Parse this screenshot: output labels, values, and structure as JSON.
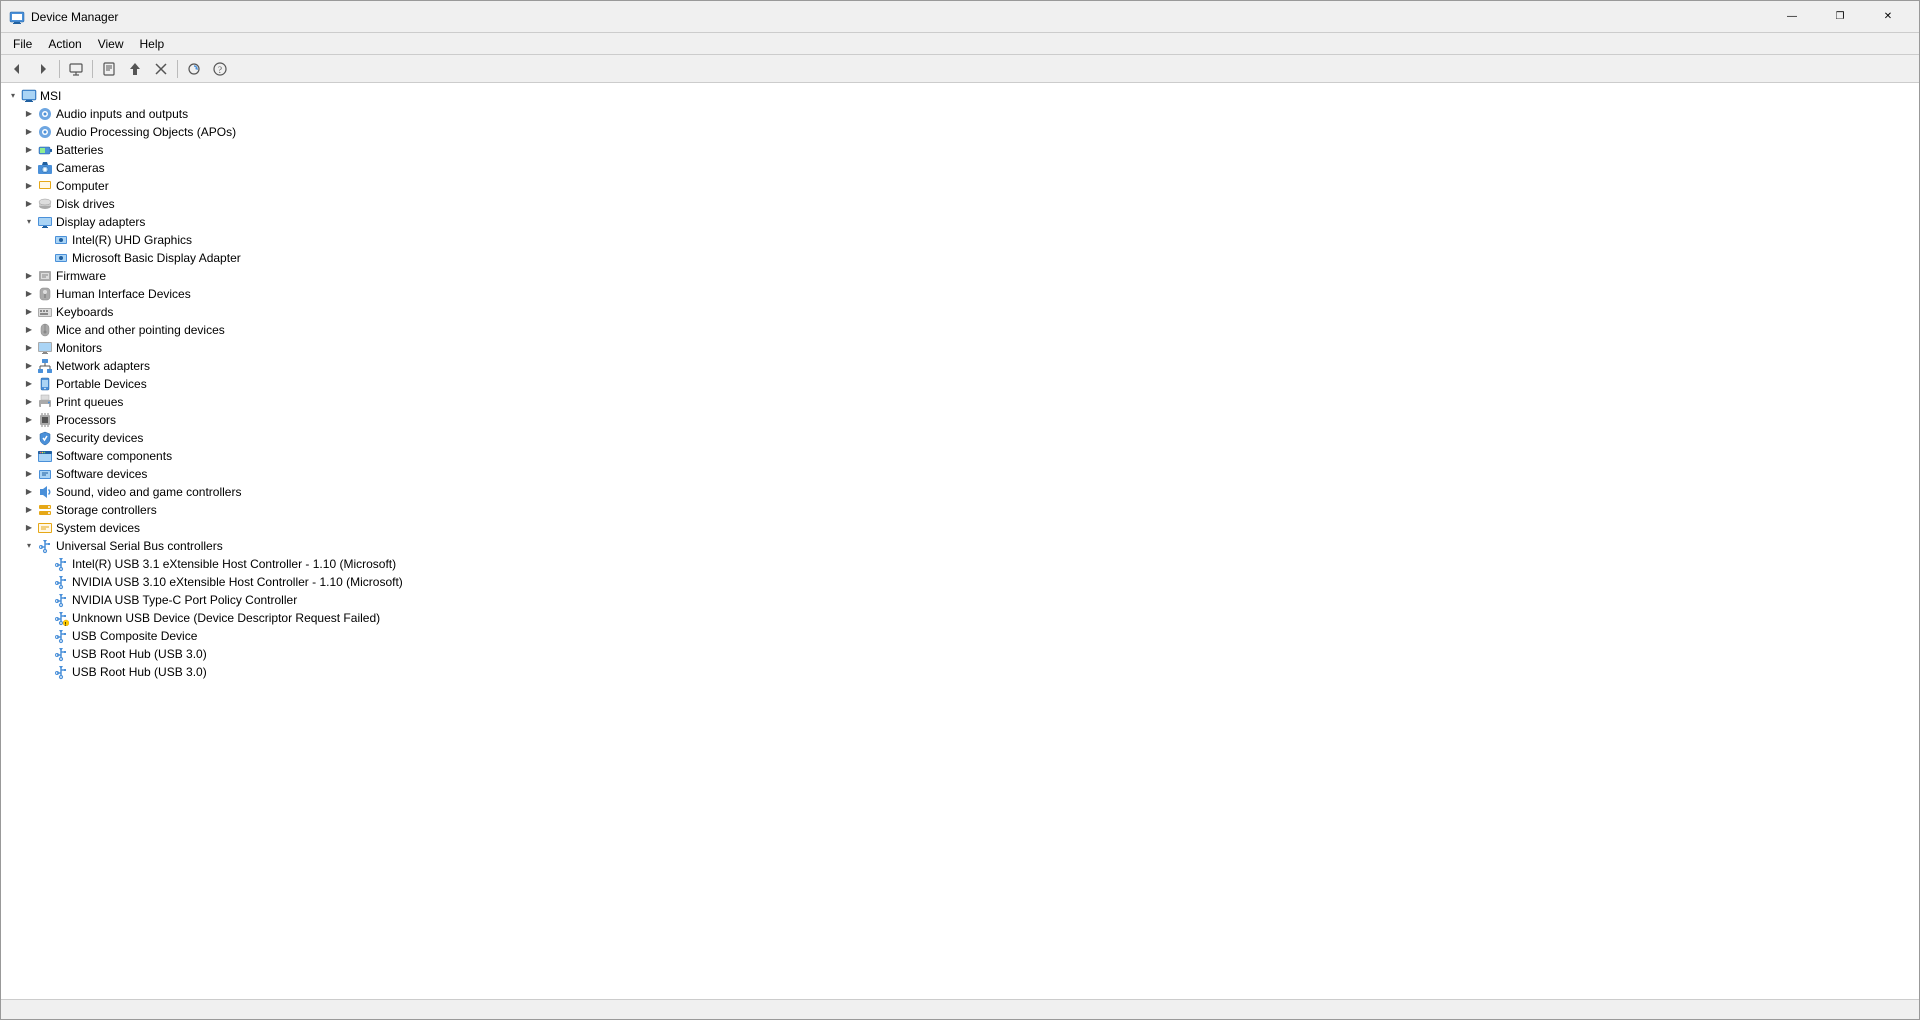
{
  "window": {
    "title": "Device Manager",
    "icon": "device-manager-icon"
  },
  "title_buttons": {
    "minimize": "—",
    "restore": "❐",
    "close": "✕"
  },
  "menu": {
    "items": [
      {
        "label": "File",
        "id": "file"
      },
      {
        "label": "Action",
        "id": "action"
      },
      {
        "label": "View",
        "id": "view"
      },
      {
        "label": "Help",
        "id": "help"
      }
    ]
  },
  "toolbar": {
    "buttons": [
      {
        "name": "back-button",
        "icon": "◀"
      },
      {
        "name": "forward-button",
        "icon": "▶"
      },
      {
        "name": "refresh-button",
        "icon": "⟳"
      },
      {
        "name": "properties-button",
        "icon": "🔲"
      },
      {
        "name": "update-driver-button",
        "icon": "⬆"
      },
      {
        "name": "uninstall-button",
        "icon": "✕"
      },
      {
        "name": "scan-hardware-button",
        "icon": "🔍"
      },
      {
        "name": "help-button",
        "icon": "?"
      }
    ]
  },
  "tree": {
    "root": {
      "label": "MSI",
      "expanded": true,
      "children": [
        {
          "label": "Audio inputs and outputs",
          "expanded": false,
          "icon": "audio",
          "children": []
        },
        {
          "label": "Audio Processing Objects (APOs)",
          "expanded": false,
          "icon": "audio",
          "children": []
        },
        {
          "label": "Batteries",
          "expanded": false,
          "icon": "battery",
          "children": []
        },
        {
          "label": "Cameras",
          "expanded": false,
          "icon": "camera",
          "children": []
        },
        {
          "label": "Computer",
          "expanded": false,
          "icon": "computer",
          "children": []
        },
        {
          "label": "Disk drives",
          "expanded": false,
          "icon": "disk",
          "children": []
        },
        {
          "label": "Display adapters",
          "expanded": true,
          "icon": "display",
          "children": [
            {
              "label": "Intel(R) UHD Graphics",
              "icon": "display-device"
            },
            {
              "label": "Microsoft Basic Display Adapter",
              "icon": "display-device"
            }
          ]
        },
        {
          "label": "Firmware",
          "expanded": false,
          "icon": "firmware",
          "children": []
        },
        {
          "label": "Human Interface Devices",
          "expanded": false,
          "icon": "hid",
          "children": []
        },
        {
          "label": "Keyboards",
          "expanded": false,
          "icon": "keyboard",
          "children": []
        },
        {
          "label": "Mice and other pointing devices",
          "expanded": false,
          "icon": "mouse",
          "children": []
        },
        {
          "label": "Monitors",
          "expanded": false,
          "icon": "monitor",
          "children": []
        },
        {
          "label": "Network adapters",
          "expanded": false,
          "icon": "network",
          "children": []
        },
        {
          "label": "Portable Devices",
          "expanded": false,
          "icon": "portable",
          "children": []
        },
        {
          "label": "Print queues",
          "expanded": false,
          "icon": "printer",
          "children": []
        },
        {
          "label": "Processors",
          "expanded": false,
          "icon": "processor",
          "children": []
        },
        {
          "label": "Security devices",
          "expanded": false,
          "icon": "security",
          "children": []
        },
        {
          "label": "Software components",
          "expanded": false,
          "icon": "software",
          "children": []
        },
        {
          "label": "Software devices",
          "expanded": false,
          "icon": "software2",
          "children": []
        },
        {
          "label": "Sound, video and game controllers",
          "expanded": false,
          "icon": "sound",
          "children": []
        },
        {
          "label": "Storage controllers",
          "expanded": false,
          "icon": "storage",
          "children": []
        },
        {
          "label": "System devices",
          "expanded": false,
          "icon": "system",
          "children": []
        },
        {
          "label": "Universal Serial Bus controllers",
          "expanded": true,
          "icon": "usb",
          "children": [
            {
              "label": "Intel(R) USB 3.1 eXtensible Host Controller - 1.10 (Microsoft)",
              "icon": "usb-device"
            },
            {
              "label": "NVIDIA USB 3.10 eXtensible Host Controller - 1.10 (Microsoft)",
              "icon": "usb-device"
            },
            {
              "label": "NVIDIA USB Type-C Port Policy Controller",
              "icon": "usb-device"
            },
            {
              "label": "Unknown USB Device (Device Descriptor Request Failed)",
              "icon": "usb-warning"
            },
            {
              "label": "USB Composite Device",
              "icon": "usb-device"
            },
            {
              "label": "USB Root Hub (USB 3.0)",
              "icon": "usb-device"
            },
            {
              "label": "USB Root Hub (USB 3.0)",
              "icon": "usb-device"
            }
          ]
        }
      ]
    }
  }
}
